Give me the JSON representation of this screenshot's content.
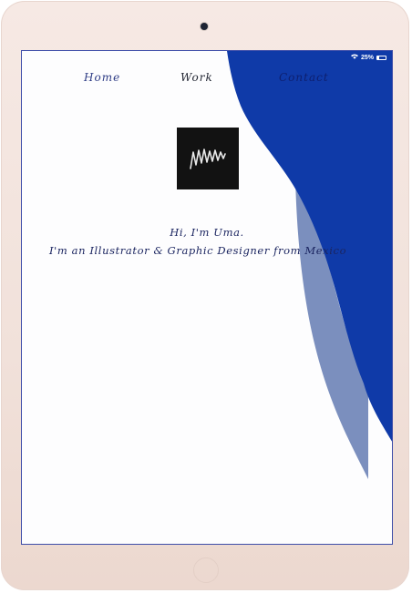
{
  "status_bar": {
    "battery": "25%"
  },
  "nav": {
    "home": "Home",
    "work": "Work",
    "contact": "Contact"
  },
  "hero": {
    "greeting": "Hi, I'm Uma.",
    "tagline": "I'm an Illustrator & Graphic Designer from Mexico"
  },
  "colors": {
    "accent_blue": "#0f3aa8",
    "accent_blue_light": "#7b8fbe",
    "logo_bg": "#121212",
    "device_frame": "#f3e4de"
  },
  "icons": [
    "camera-icon",
    "wifi-icon",
    "battery-icon",
    "home-button-icon",
    "signature-logo"
  ]
}
